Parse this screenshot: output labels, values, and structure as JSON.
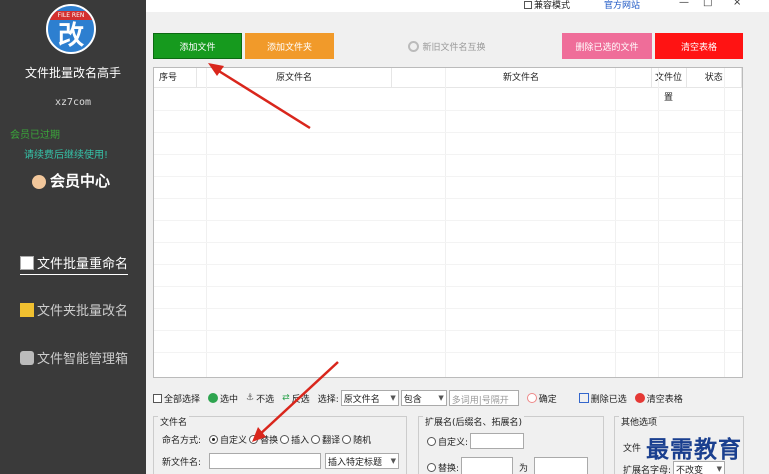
{
  "sidebar": {
    "logo_band_text": "FILE REN",
    "logo_glyph": "改",
    "app_title": "文件批量改名高手",
    "site": "xz7com",
    "member_status": "会员已过期",
    "renew_text": "请续费后继续使用!",
    "member_center": "会员中心",
    "nav": [
      {
        "label": "文件批量重命名",
        "active": true
      },
      {
        "label": "文件夹批量改名",
        "active": false
      },
      {
        "label": "文件智能管理箱",
        "active": false
      }
    ]
  },
  "titlebar": {
    "compat_mode": "兼容模式",
    "official_site": "官方网站",
    "minimize": "—",
    "maximize": "□",
    "close": "×"
  },
  "toolbar": {
    "add_file": "添加文件",
    "add_folder": "添加文件夹",
    "swap_names": "新旧文件名互换",
    "delete_selected": "删除已选的文件",
    "clear_table": "清空表格"
  },
  "table": {
    "headers": [
      "序号",
      "原文件名",
      "新文件名",
      "文件位置",
      "状态"
    ],
    "rows": []
  },
  "bottom_bar": {
    "select_all": "全部选择",
    "select": "选中",
    "deselect": "不选",
    "invert": "反选",
    "choose_label": "选择:",
    "field_select": "原文件名",
    "match_select": "包含",
    "keyword_placeholder": "多词用|号隔开",
    "confirm": "确定",
    "delete_selected": "删除已选",
    "clear_table": "清空表格"
  },
  "filename_group": {
    "title": "文件名",
    "mode_label": "命名方式:",
    "modes": [
      "自定义",
      "替换",
      "插入",
      "翻译",
      "随机"
    ],
    "selected_mode": "自定义",
    "new_name_label": "新文件名:",
    "new_name_value": "",
    "insert_select": "插入特定标题"
  },
  "ext_group": {
    "title": "扩展名(后缀名、拓展名)",
    "custom_label": "自定义:",
    "replace_label": "替换:",
    "as_label": "为"
  },
  "other_group": {
    "title": "其他选项",
    "file_label": "文件",
    "ext_case_label": "扩展名字母:",
    "ext_case_value": "不改变"
  },
  "watermark": "最需教育"
}
